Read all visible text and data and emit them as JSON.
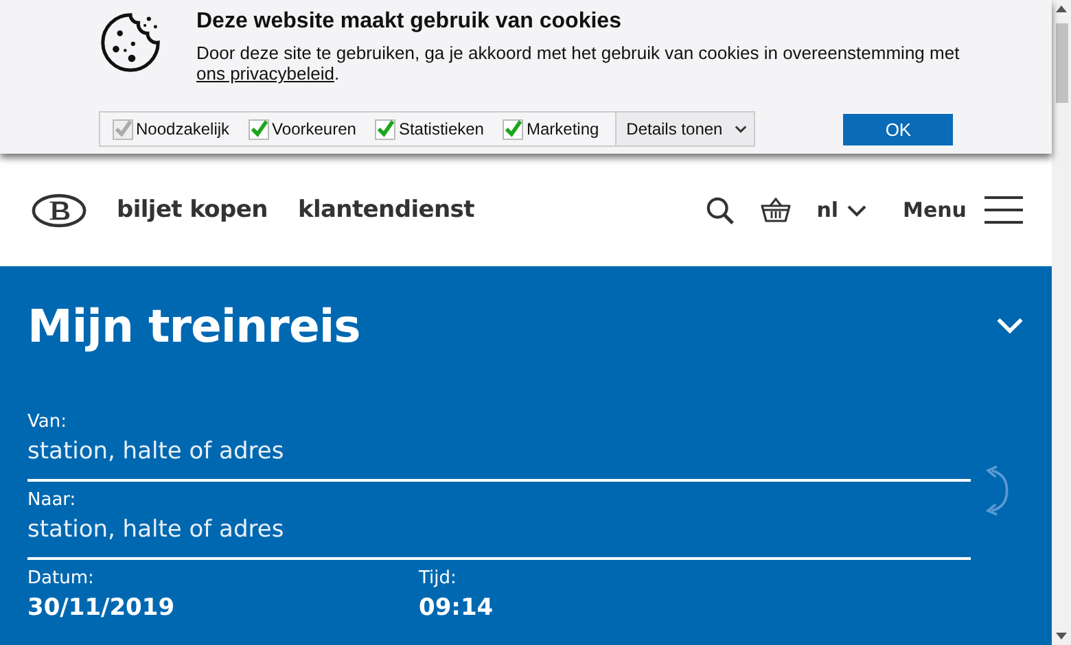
{
  "cookie_banner": {
    "title": "Deze website maakt gebruik van cookies",
    "text": "Door deze site te gebruiken, ga je akkoord met het gebruik van cookies in overeenstemming met",
    "link": "ons privacybeleid",
    "link_suffix": ".",
    "options": [
      {
        "label": "Noodzakelijk",
        "checked": true,
        "disabled": true
      },
      {
        "label": "Voorkeuren",
        "checked": true,
        "disabled": false
      },
      {
        "label": "Statistieken",
        "checked": true,
        "disabled": false
      },
      {
        "label": "Marketing",
        "checked": true,
        "disabled": false
      }
    ],
    "details": "Details tonen",
    "ok": "OK"
  },
  "header": {
    "nav": [
      "biljet kopen",
      "klantendienst"
    ],
    "language": "nl",
    "menu": "Menu"
  },
  "planner": {
    "title": "Mijn treinreis",
    "from": {
      "label": "Van:",
      "placeholder": "station, halte of adres"
    },
    "to": {
      "label": "Naar:",
      "placeholder": "station, halte of adres"
    },
    "date": {
      "label": "Datum:",
      "value": "30/11/2019"
    },
    "time": {
      "label": "Tijd:",
      "value": "09:14"
    }
  }
}
